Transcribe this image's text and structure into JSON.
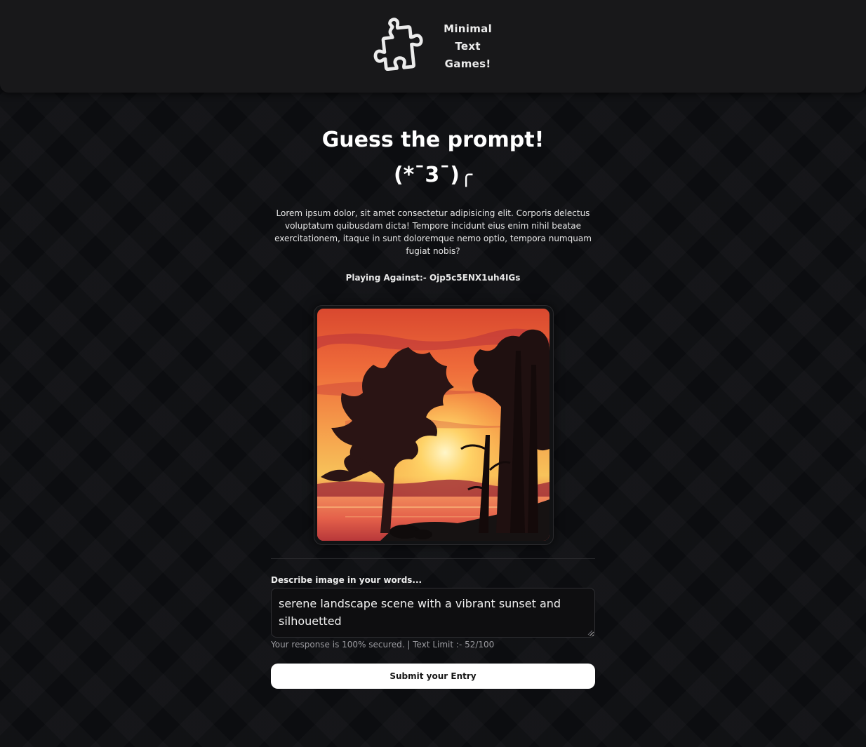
{
  "header": {
    "brand_title": "Minimal\nText\nGames!",
    "logo_icon": "puzzle-piece-icon"
  },
  "main": {
    "title": "Guess the prompt!",
    "kaomoji": "(*¯3¯)╭",
    "description": "Lorem ipsum dolor, sit amet consectetur adipisicing elit. Corporis delectus voluptatum quibusdam dicta! Tempore incidunt eius enim nihil beatae exercitationem, itaque in sunt doloremque nemo optio, tempora numquam fugiat nobis?",
    "playing_against": "Playing Against:- Ojp5c5ENX1uh4IGs",
    "image_icon": "sunset-silhouette-trees-image"
  },
  "form": {
    "label": "Describe image in your words...",
    "value": "serene landscape scene with a vibrant sunset and silhouetted",
    "helper": "Your response is 100% secured. | Text Limit :- 52/100",
    "submit_label": "Submit your Entry"
  },
  "colors": {
    "background": "#0c0d10",
    "header": "#18181a",
    "button_bg": "#ffffff",
    "button_text": "#151515"
  }
}
